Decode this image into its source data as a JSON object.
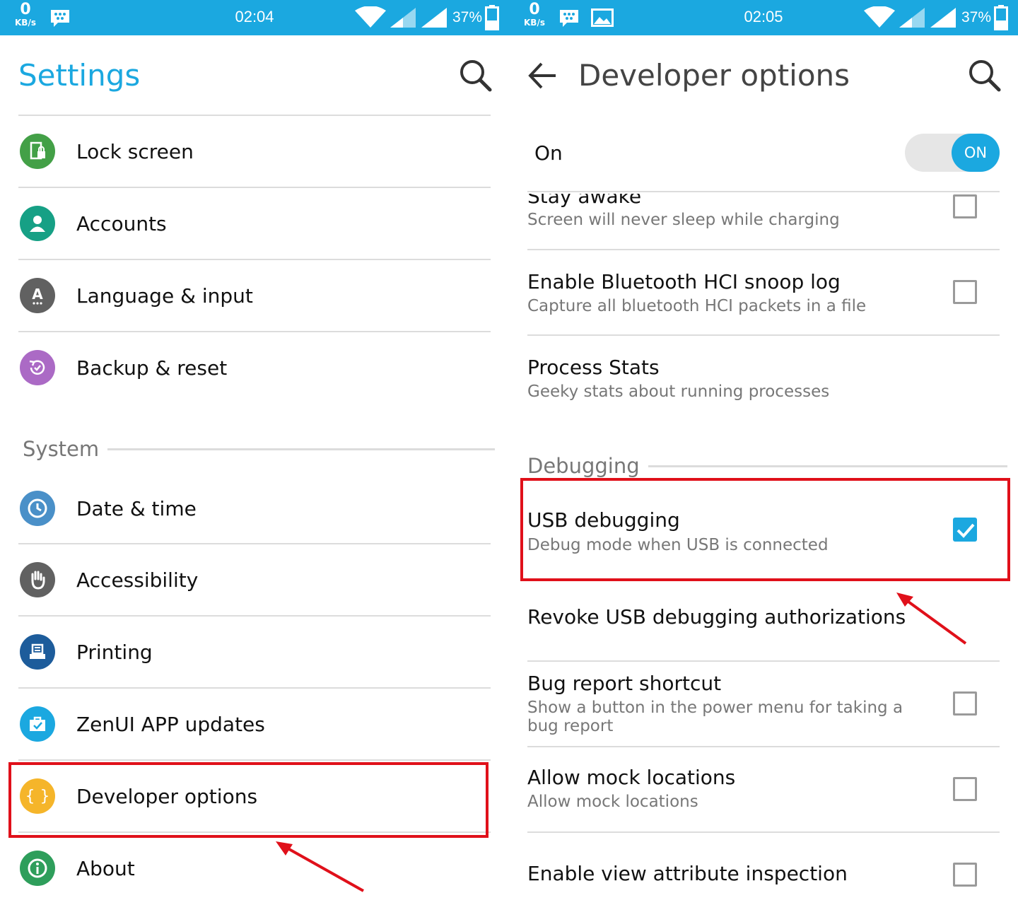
{
  "left": {
    "status_bar": {
      "speed_value": "0",
      "speed_unit": "KB/s",
      "time": "02:04",
      "battery": "37%"
    },
    "title": "Settings",
    "items_top": [
      {
        "label": "Lock screen",
        "icon": "lock-screen-icon",
        "color": "#43a047"
      },
      {
        "label": "Accounts",
        "icon": "accounts-icon",
        "color": "#16a085"
      },
      {
        "label": "Language & input",
        "icon": "language-icon",
        "color": "#616161"
      },
      {
        "label": "Backup & reset",
        "icon": "backup-icon",
        "color": "#ab6ac5"
      }
    ],
    "section_system": "System",
    "items_system": [
      {
        "label": "Date & time",
        "icon": "clock-icon",
        "color": "#4a90c8"
      },
      {
        "label": "Accessibility",
        "icon": "hand-icon",
        "color": "#616161"
      },
      {
        "label": "Printing",
        "icon": "printer-icon",
        "color": "#1d5c9b"
      },
      {
        "label": "ZenUI APP updates",
        "icon": "briefcase-icon",
        "color": "#1ba8e0"
      },
      {
        "label": "Developer options",
        "icon": "braces-icon",
        "color": "#f5b52a"
      },
      {
        "label": "About",
        "icon": "info-icon",
        "color": "#2e9e5b"
      }
    ]
  },
  "right": {
    "status_bar": {
      "speed_value": "0",
      "speed_unit": "KB/s",
      "time": "02:05",
      "battery": "37%"
    },
    "title": "Developer options",
    "master": {
      "label": "On",
      "toggle_text": "ON"
    },
    "items": [
      {
        "title": "Stay awake",
        "subtitle": "Screen will never sleep while charging",
        "checked": false
      },
      {
        "title": "Enable Bluetooth HCI snoop log",
        "subtitle": "Capture all bluetooth HCI packets in a file",
        "checked": false
      },
      {
        "title": "Process Stats",
        "subtitle": "Geeky stats about running processes"
      }
    ],
    "section_debugging": "Debugging",
    "debug_items": [
      {
        "title": "USB debugging",
        "subtitle": "Debug mode when USB is connected",
        "checked": true
      },
      {
        "title": "Revoke USB debugging authorizations"
      },
      {
        "title": "Bug report shortcut",
        "subtitle": "Show a button in the power menu for taking a bug report",
        "checked": false
      },
      {
        "title": "Allow mock locations",
        "subtitle": "Allow mock locations",
        "checked": false
      },
      {
        "title": "Enable view attribute inspection",
        "checked": false
      }
    ]
  },
  "accent_color": "#1ba8e0",
  "highlight_color": "#e0101a"
}
